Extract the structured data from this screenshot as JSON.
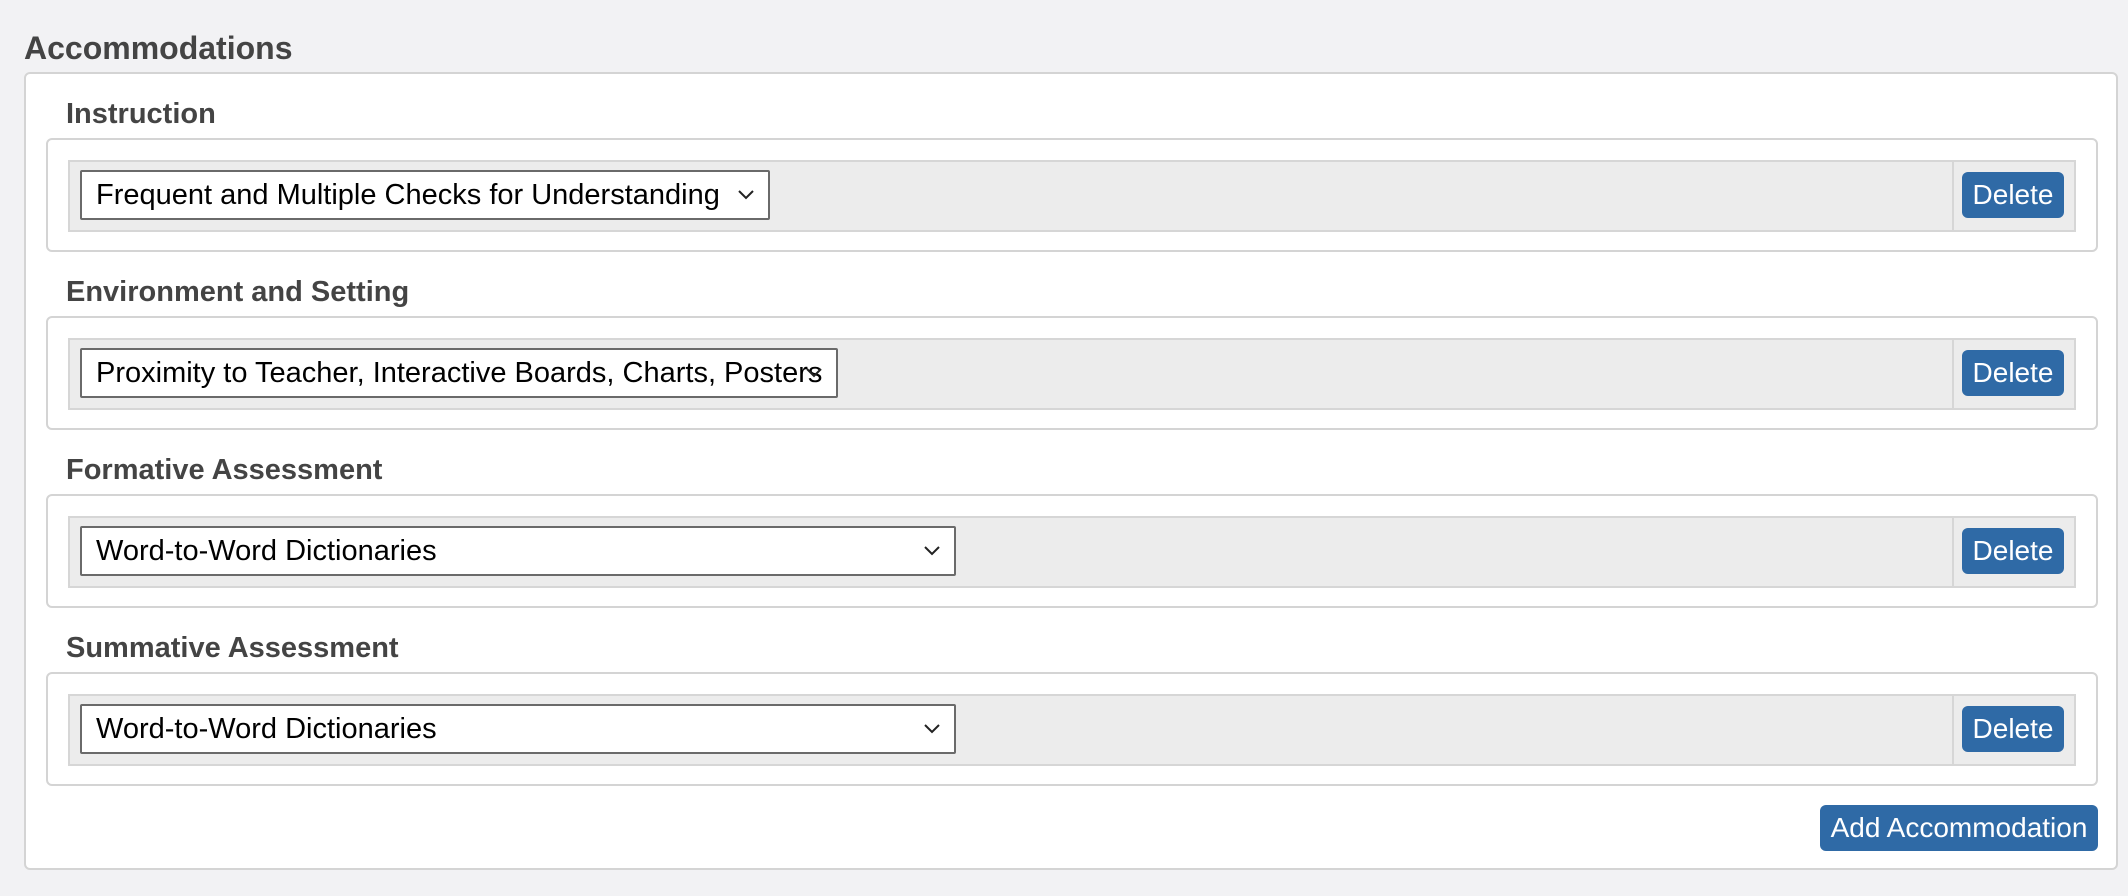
{
  "page": {
    "title": "Accommodations"
  },
  "sections": [
    {
      "heading": "Instruction",
      "selected": "Frequent and Multiple Checks for Understanding",
      "delete_label": "Delete"
    },
    {
      "heading": "Environment and Setting",
      "selected": "Proximity to Teacher, Interactive Boards, Charts, Posters",
      "delete_label": "Delete"
    },
    {
      "heading": "Formative Assessment",
      "selected": "Word-to-Word Dictionaries",
      "delete_label": "Delete"
    },
    {
      "heading": "Summative Assessment",
      "selected": "Word-to-Word Dictionaries",
      "delete_label": "Delete"
    }
  ],
  "actions": {
    "add_label": "Add Accommodation"
  },
  "icons": {
    "dropdown": "chevron-down-icon"
  },
  "colors": {
    "primary_button": "#2f6aa6",
    "heading_text": "#444444",
    "row_background": "#ececec",
    "page_background": "#f2f2f4"
  }
}
